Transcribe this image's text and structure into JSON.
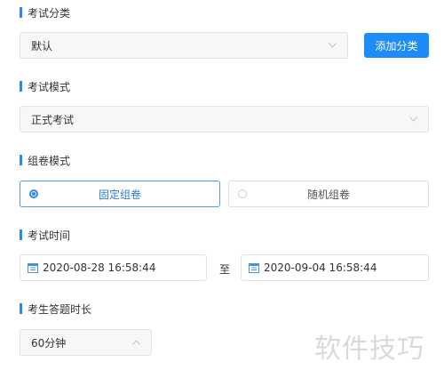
{
  "category": {
    "title": "考试分类",
    "select_value": "默认",
    "add_button": "添加分类"
  },
  "mode": {
    "title": "考试模式",
    "select_value": "正式考试"
  },
  "paper_mode": {
    "title": "组卷模式",
    "options": [
      {
        "label": "固定组卷",
        "selected": true
      },
      {
        "label": "随机组卷",
        "selected": false
      }
    ]
  },
  "exam_time": {
    "title": "考试时间",
    "start": "2020-08-28 16:58:44",
    "to": "至",
    "end": "2020-09-04 16:58:44"
  },
  "duration": {
    "title": "考生答题时长",
    "select_value": "60分钟"
  },
  "watermark": "软件技巧",
  "colors": {
    "accent": "#1d8cf8",
    "section_bar": "#2f88f0"
  },
  "icons": {
    "select_arrow": "chevron-down-icon",
    "duration_arrow": "chevron-up-icon",
    "date": "calendar-icon"
  }
}
